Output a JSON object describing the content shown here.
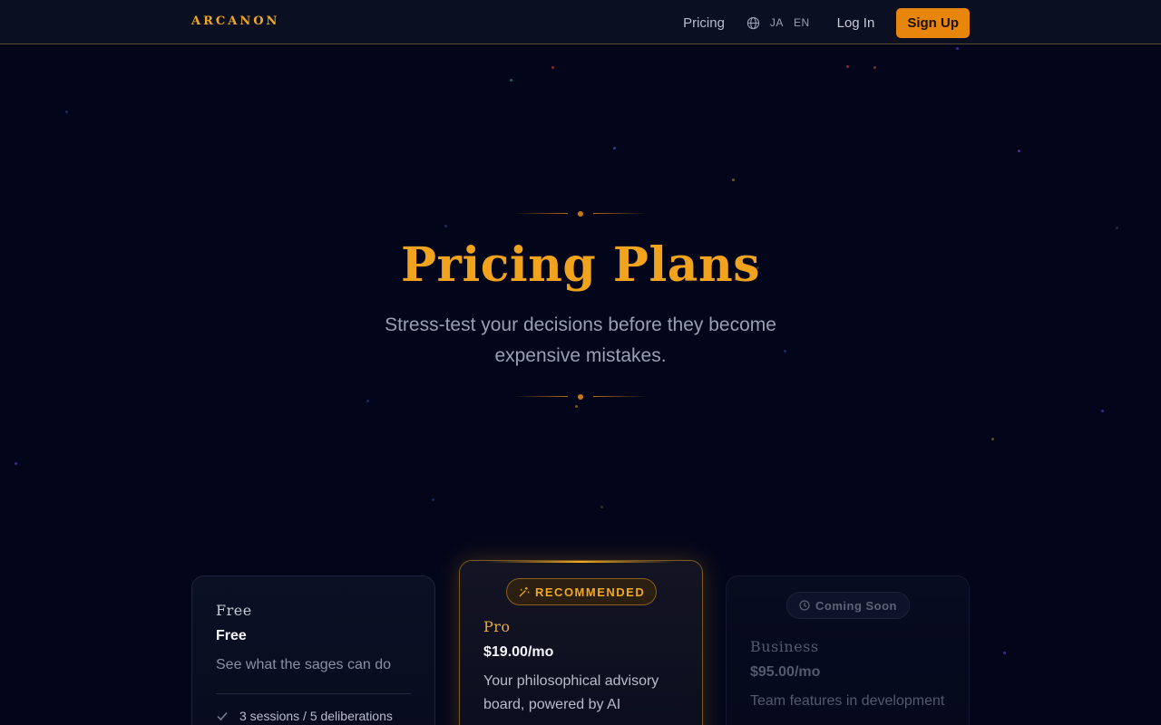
{
  "nav": {
    "logo": "ARCANON",
    "pricing_link": "Pricing",
    "globe_icon": "globe-icon",
    "lang_ja": "JA",
    "lang_en": "EN",
    "login": "Log In",
    "signup": "Sign Up"
  },
  "hero": {
    "title": "Pricing Plans",
    "subtitle": "Stress-test your decisions before they become expensive mistakes."
  },
  "plans": [
    {
      "label": "Free",
      "price": "Free",
      "description": "See what the sages can do",
      "features": [
        "3 sessions / 5 deliberations"
      ]
    },
    {
      "badge": "RECOMMENDED",
      "badge_icon": "sparkle-icon",
      "label": "Pro",
      "price": "$19.00/mo",
      "description": "Your philosophical advisory board, powered by AI"
    },
    {
      "status": "Coming Soon",
      "status_icon": "clock-icon",
      "label": "Business",
      "price": "$95.00/mo",
      "description": "Team features in development"
    }
  ],
  "colors": {
    "background": "#03061a",
    "accent": "#f2a31d",
    "signup_button": "#e8860b",
    "nav_border": "#5a4a26"
  }
}
